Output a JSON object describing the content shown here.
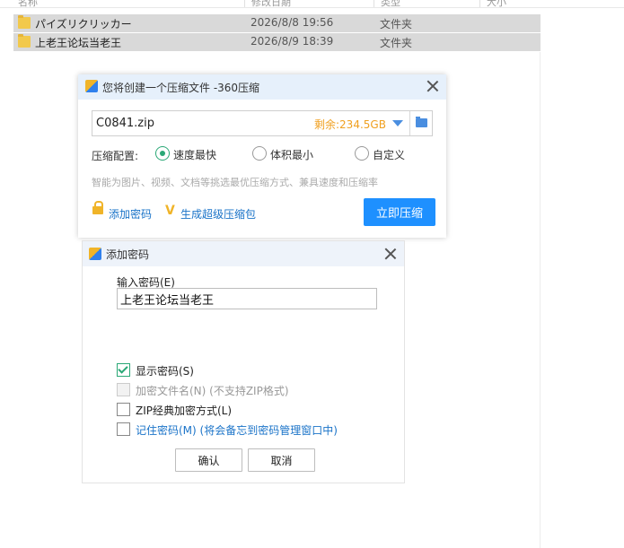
{
  "explorer": {
    "columns": [
      "名称",
      "修改日期",
      "类型",
      "大小"
    ],
    "rows": [
      {
        "name": "パイズリクリッカー",
        "date": "2026/8/8 19:56",
        "type": "文件夹"
      },
      {
        "name": "上老王论坛当老王",
        "date": "2026/8/9 18:39",
        "type": "文件夹"
      }
    ]
  },
  "compress_dialog": {
    "title": "您将创建一个压缩文件 -360压缩",
    "filename": "C0841.zip",
    "remaining": "剩余:234.5GB",
    "config_label": "压缩配置:",
    "options": [
      "速度最快",
      "体积最小",
      "自定义"
    ],
    "selected_option": "速度最快",
    "hint": "智能为图片、视频、文档等挑选最优压缩方式、兼具速度和压缩率",
    "add_password": "添加密码",
    "super_compress": "生成超级压缩包",
    "compress_now": "立即压缩"
  },
  "password_dialog": {
    "title": "添加密码",
    "input_label": "输入密码(E)",
    "password_value": "上老王论坛当老王",
    "checkboxes": [
      {
        "label": "显示密码(S)",
        "checked": true,
        "disabled": false
      },
      {
        "label": "加密文件名(N) (不支持ZIP格式)",
        "checked": false,
        "disabled": true
      },
      {
        "label": "ZIP经典加密方式(L)",
        "checked": false,
        "disabled": false
      },
      {
        "label": "记住密码(M) (将会备忘到密码管理窗口中)",
        "checked": false,
        "disabled": false
      }
    ],
    "ok": "确认",
    "cancel": "取消"
  },
  "colors": {
    "accent": "#1e90ff",
    "radio_selected": "#2aa876",
    "space_text": "#f0a020",
    "link": "#1a73c8"
  }
}
